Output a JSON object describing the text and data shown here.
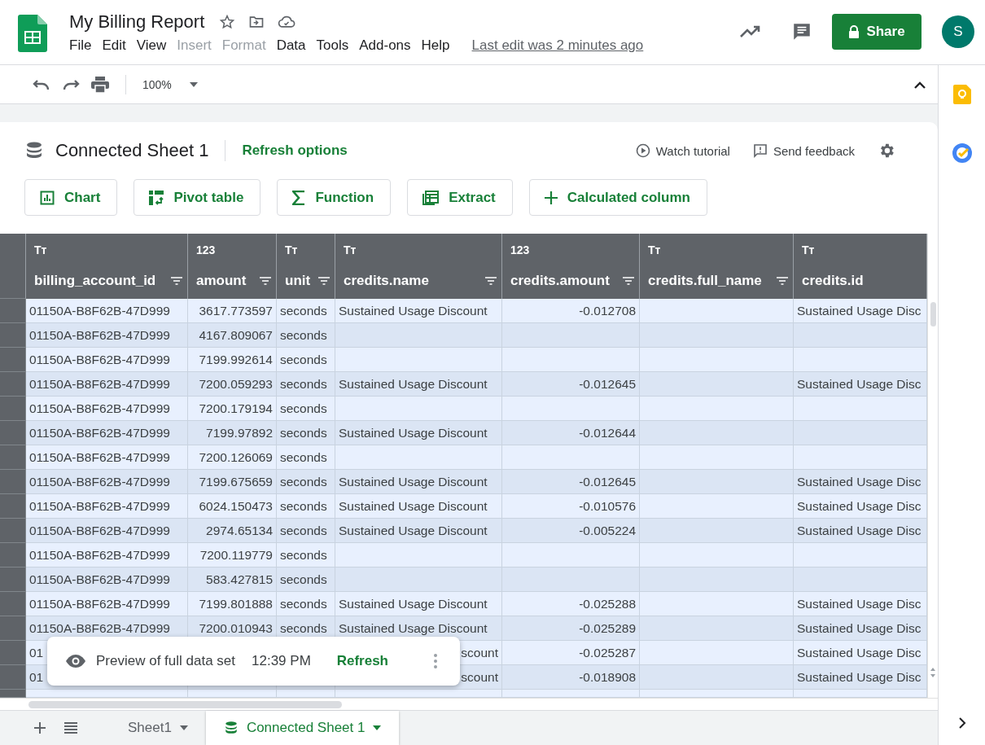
{
  "document": {
    "title": "My Billing Report",
    "menu": [
      {
        "label": "File",
        "disabled": false
      },
      {
        "label": "Edit",
        "disabled": false
      },
      {
        "label": "View",
        "disabled": false
      },
      {
        "label": "Insert",
        "disabled": true
      },
      {
        "label": "Format",
        "disabled": true
      },
      {
        "label": "Data",
        "disabled": false
      },
      {
        "label": "Tools",
        "disabled": false
      },
      {
        "label": "Add-ons",
        "disabled": false
      },
      {
        "label": "Help",
        "disabled": false
      }
    ],
    "last_edit": "Last edit was 2 minutes ago",
    "share": "Share",
    "avatar": "S"
  },
  "toolbar": {
    "zoom": "100%"
  },
  "connected_sheet": {
    "title": "Connected Sheet 1",
    "refresh_options": "Refresh options",
    "links": [
      "Watch tutorial",
      "Send feedback"
    ],
    "actions": [
      "Chart",
      "Pivot table",
      "Function",
      "Extract",
      "Calculated column"
    ]
  },
  "table": {
    "columns": [
      {
        "kind": "text",
        "type_label": "Tт",
        "name": "billing_account_id",
        "filter": true
      },
      {
        "kind": "number",
        "type_label": "123",
        "name": "amount",
        "filter": true
      },
      {
        "kind": "text",
        "type_label": "Tт",
        "name": "unit",
        "filter": true
      },
      {
        "kind": "text",
        "type_label": "Tт",
        "name": "credits.name",
        "filter": true
      },
      {
        "kind": "number",
        "type_label": "123",
        "name": "credits.amount",
        "filter": true
      },
      {
        "kind": "text",
        "type_label": "Tт",
        "name": "credits.full_name",
        "filter": true
      },
      {
        "kind": "text",
        "type_label": "Tт",
        "name": "credits.id",
        "filter": false
      }
    ],
    "rows": [
      {
        "kind": "full",
        "cells": [
          "01150A-B8F62B-47D999",
          "3617.773597",
          "seconds",
          "Sustained Usage Discount",
          "-0.012708",
          "",
          "Sustained Usage Disc"
        ]
      },
      {
        "kind": "full",
        "cells": [
          "01150A-B8F62B-47D999",
          "4167.809067",
          "seconds",
          "",
          "",
          "",
          ""
        ]
      },
      {
        "kind": "full",
        "cells": [
          "01150A-B8F62B-47D999",
          "7199.992614",
          "seconds",
          "",
          "",
          "",
          ""
        ]
      },
      {
        "kind": "full",
        "cells": [
          "01150A-B8F62B-47D999",
          "7200.059293",
          "seconds",
          "Sustained Usage Discount",
          "-0.012645",
          "",
          "Sustained Usage Disc"
        ]
      },
      {
        "kind": "full",
        "cells": [
          "01150A-B8F62B-47D999",
          "7200.179194",
          "seconds",
          "",
          "",
          "",
          ""
        ]
      },
      {
        "kind": "full",
        "cells": [
          "01150A-B8F62B-47D999",
          "7199.97892",
          "seconds",
          "Sustained Usage Discount",
          "-0.012644",
          "",
          ""
        ]
      },
      {
        "kind": "full",
        "cells": [
          "01150A-B8F62B-47D999",
          "7200.126069",
          "seconds",
          "",
          "",
          "",
          ""
        ]
      },
      {
        "kind": "full",
        "cells": [
          "01150A-B8F62B-47D999",
          "7199.675659",
          "seconds",
          "Sustained Usage Discount",
          "-0.012645",
          "",
          "Sustained Usage Disc"
        ]
      },
      {
        "kind": "full",
        "cells": [
          "01150A-B8F62B-47D999",
          "6024.150473",
          "seconds",
          "Sustained Usage Discount",
          "-0.010576",
          "",
          "Sustained Usage Disc"
        ]
      },
      {
        "kind": "full",
        "cells": [
          "01150A-B8F62B-47D999",
          "2974.65134",
          "seconds",
          "Sustained Usage Discount",
          "-0.005224",
          "",
          "Sustained Usage Disc"
        ]
      },
      {
        "kind": "full",
        "cells": [
          "01150A-B8F62B-47D999",
          "7200.119779",
          "seconds",
          "",
          "",
          "",
          ""
        ]
      },
      {
        "kind": "full",
        "cells": [
          "01150A-B8F62B-47D999",
          "583.427815",
          "seconds",
          "",
          "",
          "",
          ""
        ]
      },
      {
        "kind": "full",
        "cells": [
          "01150A-B8F62B-47D999",
          "7199.801888",
          "seconds",
          "Sustained Usage Discount",
          "-0.025288",
          "",
          "Sustained Usage Disc"
        ]
      },
      {
        "kind": "full",
        "cells": [
          "01150A-B8F62B-47D999",
          "7200.010943",
          "seconds",
          "Sustained Usage Discount",
          "-0.025289",
          "",
          "Sustained Usage Disc"
        ]
      },
      {
        "kind": "covered",
        "cells": [
          "01",
          "",
          "",
          "scount",
          "-0.025287",
          "",
          "Sustained Usage Disc"
        ]
      },
      {
        "kind": "covered",
        "cells": [
          "01",
          "",
          "",
          "scount",
          "-0.018908",
          "",
          "Sustained Usage Disc"
        ]
      }
    ]
  },
  "toast": {
    "text": "Preview of full data set",
    "time": "12:39 PM",
    "action": "Refresh"
  },
  "sheet_tabs": [
    {
      "label": "Sheet1",
      "selected": false,
      "kind": "plain"
    },
    {
      "label": "Connected Sheet 1",
      "selected": true,
      "kind": "connected"
    }
  ]
}
